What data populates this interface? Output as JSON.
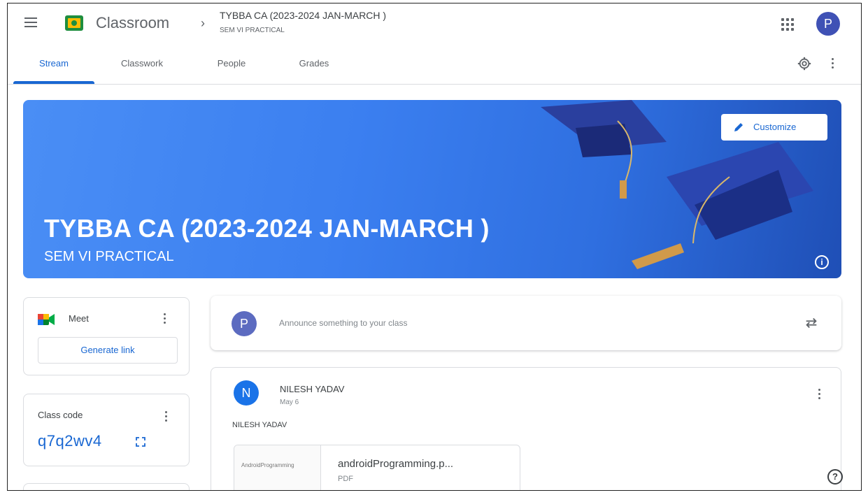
{
  "header": {
    "app_title": "Classroom",
    "breadcrumb_separator": "›",
    "class_title": "TYBBA CA (2023-2024 JAN-MARCH )",
    "class_section": "SEM VI PRACTICAL",
    "avatar_initial": "P"
  },
  "tabs": [
    {
      "label": "Stream",
      "active": true
    },
    {
      "label": "Classwork",
      "active": false
    },
    {
      "label": "People",
      "active": false
    },
    {
      "label": "Grades",
      "active": false
    }
  ],
  "banner": {
    "title": "TYBBA CA (2023-2024 JAN-MARCH )",
    "subtitle": "SEM VI PRACTICAL",
    "customize_label": "Customize",
    "info_glyph": "i"
  },
  "meet": {
    "label": "Meet",
    "generate_link_label": "Generate link"
  },
  "class_code": {
    "label": "Class code",
    "value": "q7q2wv4"
  },
  "announce": {
    "avatar_initial": "P",
    "placeholder": "Announce something to your class"
  },
  "post": {
    "avatar_initial": "N",
    "author": "NILESH YADAV",
    "date": "May 6",
    "body": "NILESH YADAV",
    "attachment": {
      "name": "androidProgramming.p...",
      "type": "PDF",
      "thumb_text": "AndroidProgramming"
    }
  },
  "help_glyph": "?",
  "colors": {
    "accent": "#1967d2",
    "banner": "#3b7ff0",
    "avatar_top": "#3f51b5",
    "post_avatar": "#1a73e8"
  }
}
